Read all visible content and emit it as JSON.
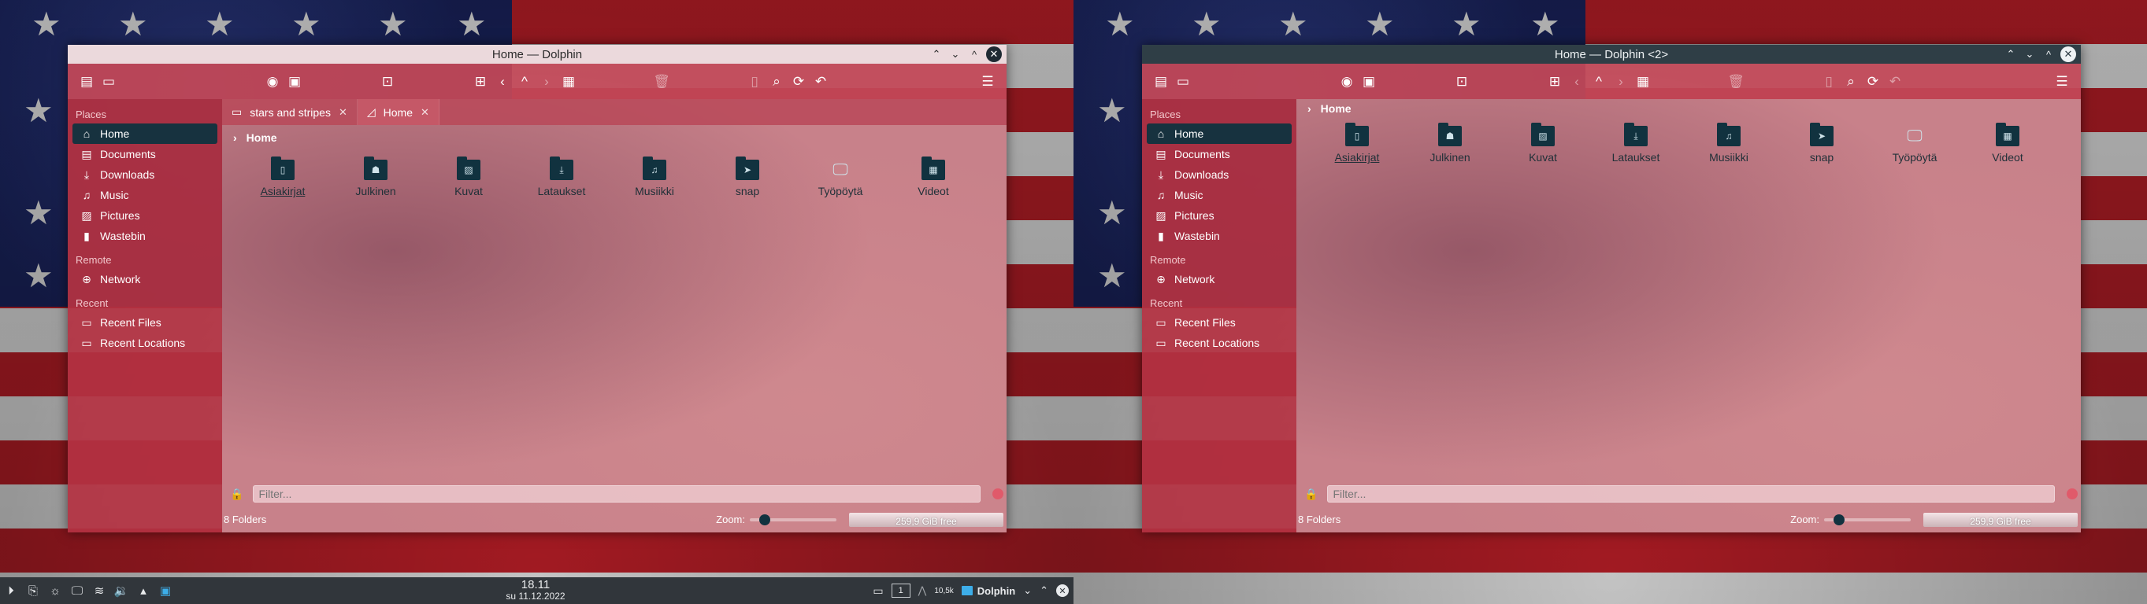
{
  "windows": [
    {
      "title": "Home — Dolphin",
      "tabs": [
        {
          "label": "stars and stripes",
          "icon": "folder-icon",
          "active": false
        },
        {
          "label": "Home",
          "icon": "home-icon",
          "active": true
        }
      ],
      "breadcrumb": "Home",
      "status": "8 Folders",
      "free": "259,9 GiB free"
    },
    {
      "title": "Home — Dolphin <2>",
      "breadcrumb": "Home",
      "status": "8 Folders",
      "free": "259,9 GiB free"
    }
  ],
  "sidebar": {
    "places_title": "Places",
    "remote_title": "Remote",
    "recent_title": "Recent",
    "places": [
      "Home",
      "Documents",
      "Downloads",
      "Music",
      "Pictures",
      "Wastebin"
    ],
    "remote": [
      "Network"
    ],
    "recent": [
      "Recent Files",
      "Recent Locations"
    ]
  },
  "folders": [
    "Asiakirjat",
    "Julkinen",
    "Kuvat",
    "Lataukset",
    "Musiikki",
    "snap",
    "Työpöytä",
    "Videot"
  ],
  "filter_placeholder": "Filter...",
  "zoom_label": "Zoom:",
  "zoom_level": 0.12,
  "panel": {
    "time": "18.11",
    "date": "su 11.12.2022",
    "desktop_number": "1",
    "network_rate": "10,5k",
    "task_label": "Dolphin"
  },
  "colors": {
    "accent": "#17323f",
    "toolbar": "#c44858",
    "panel": "#31363b"
  }
}
